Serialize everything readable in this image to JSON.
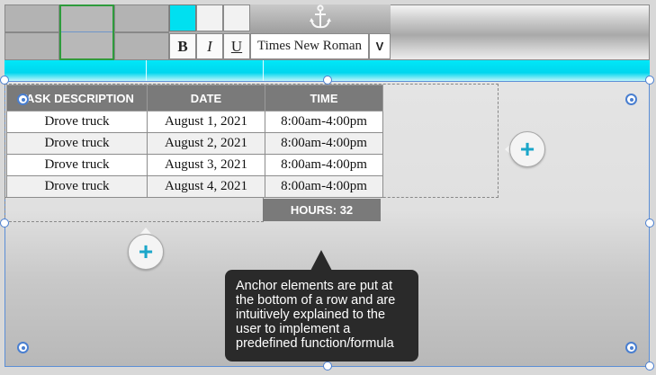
{
  "toolbar": {
    "bold_label": "B",
    "italic_label": "I",
    "underline_label": "U",
    "font_name": "Times New Roman",
    "font_dropdown_label": "V",
    "fill_color": "#00e0f0",
    "anchor_icon": "anchor-icon",
    "anchor_glyph": "⚓"
  },
  "table": {
    "headers": [
      "TASK DESCRIPTION",
      "DATE",
      "TIME"
    ],
    "rows": [
      [
        "Drove truck",
        "August 1, 2021",
        "8:00am-4:00pm"
      ],
      [
        "Drove truck",
        "August 2, 2021",
        "8:00am-4:00pm"
      ],
      [
        "Drove truck",
        "August 3, 2021",
        "8:00am-4:00pm"
      ],
      [
        "Drove truck",
        "August 4, 2021",
        "8:00am-4:00pm"
      ]
    ],
    "hours_total": "HOURS: 32"
  },
  "add_buttons": {
    "glyph": "+",
    "icon": "plus-icon"
  },
  "tooltip": {
    "text": "Anchor elements are put at the bottom of a row and are intuitively explained to the user to implement a predefined function/formula"
  },
  "colors": {
    "accent_cyan": "#00e0f0",
    "selection_blue": "#4a7fd0",
    "plus_teal": "#1ba6c9",
    "header_gray": "#7a7a7a"
  }
}
